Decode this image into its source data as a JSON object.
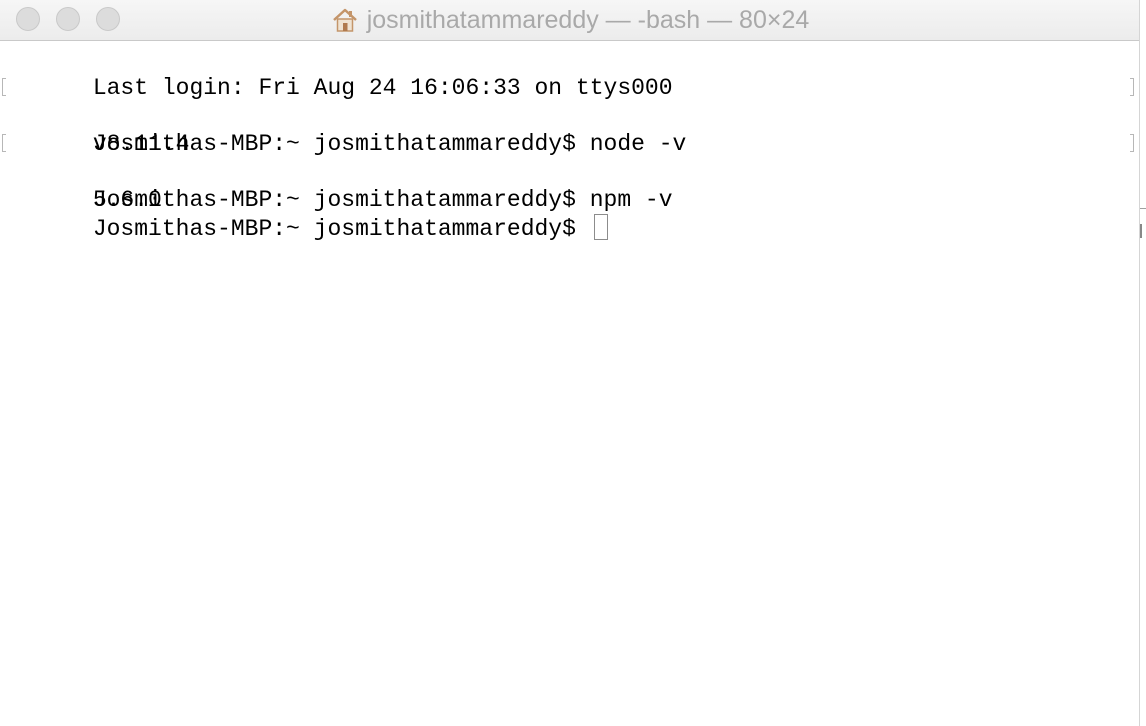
{
  "window": {
    "title": "josmithatammareddy — -bash — 80×24",
    "title_icon": "home-icon",
    "accent_color": "#a9a9a9"
  },
  "terminal": {
    "lines": [
      {
        "text": "Last login: Fri Aug 24 16:06:33 on ttys000",
        "kind": "output",
        "marked": false
      },
      {
        "text": "Josmithas-MBP:~ josmithatammareddy$ node -v",
        "kind": "command",
        "marked": true
      },
      {
        "text": "v8.11.4",
        "kind": "output",
        "marked": false
      },
      {
        "text": "Josmithas-MBP:~ josmithatammareddy$ npm -v",
        "kind": "command",
        "marked": true
      },
      {
        "text": "5.6.0",
        "kind": "output",
        "marked": false
      }
    ],
    "prompt": "Josmithas-MBP:~ josmithatammareddy$ "
  }
}
